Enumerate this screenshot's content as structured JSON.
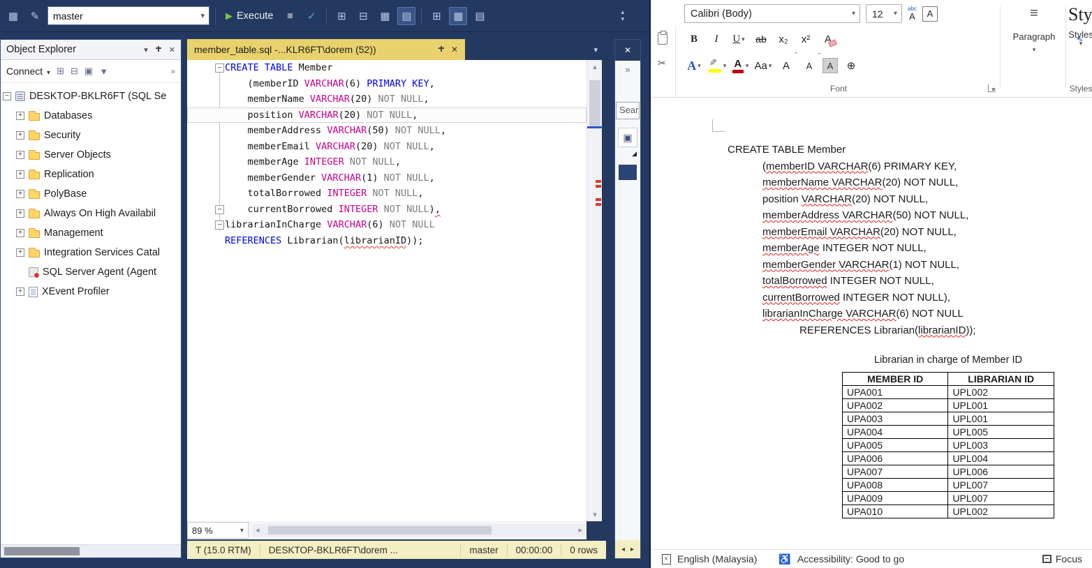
{
  "ssms": {
    "toolbar": {
      "database": "master",
      "execute": "Execute"
    },
    "object_explorer": {
      "title": "Object Explorer",
      "connect": "Connect",
      "tree": [
        {
          "label": "DESKTOP-BKLR6FT (SQL Se",
          "icon": "server",
          "expander": "minus",
          "root": true
        },
        {
          "label": "Databases",
          "icon": "folder",
          "expander": "plus"
        },
        {
          "label": "Security",
          "icon": "folder",
          "expander": "plus"
        },
        {
          "label": "Server Objects",
          "icon": "folder",
          "expander": "plus"
        },
        {
          "label": "Replication",
          "icon": "folder",
          "expander": "plus"
        },
        {
          "label": "PolyBase",
          "icon": "folder",
          "expander": "plus"
        },
        {
          "label": "Always On High Availabil",
          "icon": "folder",
          "expander": "plus"
        },
        {
          "label": "Management",
          "icon": "folder",
          "expander": "plus"
        },
        {
          "label": "Integration Services Catal",
          "icon": "folder",
          "expander": "plus"
        },
        {
          "label": "SQL Server Agent (Agent",
          "icon": "agent",
          "expander": "none"
        },
        {
          "label": "XEvent Profiler",
          "icon": "profiler",
          "expander": "plus"
        }
      ]
    },
    "editor": {
      "tab_title": "member_table.sql -...KLR6FT\\dorem (52))",
      "zoom": "89 %",
      "lines": [
        {
          "fold": true,
          "tokens": [
            {
              "t": "CREATE TABLE",
              "c": "kw"
            },
            {
              "t": " Member",
              "c": "id"
            }
          ]
        },
        {
          "tokens": [
            {
              "t": "    (memberID ",
              "c": "id"
            },
            {
              "t": "VARCHAR",
              "c": "type"
            },
            {
              "t": "(6) ",
              "c": "id"
            },
            {
              "t": "PRIMARY KEY",
              "c": "kw"
            },
            {
              "t": ",",
              "c": "id"
            }
          ]
        },
        {
          "tokens": [
            {
              "t": "    memberName ",
              "c": "id"
            },
            {
              "t": "VARCHAR",
              "c": "type"
            },
            {
              "t": "(20) ",
              "c": "id"
            },
            {
              "t": "NOT NULL",
              "c": "gray"
            },
            {
              "t": ",",
              "c": "id"
            }
          ]
        },
        {
          "current": true,
          "tokens": [
            {
              "t": "    position ",
              "c": "id"
            },
            {
              "t": "VARCHAR",
              "c": "type"
            },
            {
              "t": "(20) ",
              "c": "id"
            },
            {
              "t": "NOT NULL",
              "c": "gray"
            },
            {
              "t": ",",
              "c": "id"
            }
          ]
        },
        {
          "tokens": [
            {
              "t": "    memberAddress ",
              "c": "id"
            },
            {
              "t": "VARCHAR",
              "c": "type"
            },
            {
              "t": "(50) ",
              "c": "id"
            },
            {
              "t": "NOT NULL",
              "c": "gray"
            },
            {
              "t": ",",
              "c": "id"
            }
          ]
        },
        {
          "tokens": [
            {
              "t": "    memberEmail ",
              "c": "id"
            },
            {
              "t": "VARCHAR",
              "c": "type"
            },
            {
              "t": "(20) ",
              "c": "id"
            },
            {
              "t": "NOT NULL",
              "c": "gray"
            },
            {
              "t": ",",
              "c": "id"
            }
          ]
        },
        {
          "tokens": [
            {
              "t": "    memberAge ",
              "c": "id"
            },
            {
              "t": "INTEGER",
              "c": "type"
            },
            {
              "t": " ",
              "c": "id"
            },
            {
              "t": "NOT NULL",
              "c": "gray"
            },
            {
              "t": ",",
              "c": "id"
            }
          ]
        },
        {
          "tokens": [
            {
              "t": "    memberGender ",
              "c": "id"
            },
            {
              "t": "VARCHAR",
              "c": "type"
            },
            {
              "t": "(1) ",
              "c": "id"
            },
            {
              "t": "NOT NULL",
              "c": "gray"
            },
            {
              "t": ",",
              "c": "id"
            }
          ]
        },
        {
          "tokens": [
            {
              "t": "    totalBorrowed ",
              "c": "id"
            },
            {
              "t": "INTEGER",
              "c": "type"
            },
            {
              "t": " ",
              "c": "id"
            },
            {
              "t": "NOT NULL",
              "c": "gray"
            },
            {
              "t": ",",
              "c": "id"
            }
          ]
        },
        {
          "fold": true,
          "tokens": [
            {
              "t": "    currentBorrowed ",
              "c": "id"
            },
            {
              "t": "INTEGER",
              "c": "type"
            },
            {
              "t": " ",
              "c": "id"
            },
            {
              "t": "NOT NULL",
              "c": "gray"
            },
            {
              "t": ")",
              "c": "id"
            },
            {
              "t": ",",
              "c": "sq"
            }
          ]
        },
        {
          "fold": true,
          "tokens": [
            {
              "t": "librarianInCharge ",
              "c": "id"
            },
            {
              "t": "VARCHAR",
              "c": "type"
            },
            {
              "t": "(6) ",
              "c": "id"
            },
            {
              "t": "NOT NULL",
              "c": "gray"
            }
          ]
        },
        {
          "tokens": [
            {
              "t": "REFERENCES",
              "c": "kw"
            },
            {
              "t": " Librarian(",
              "c": "id"
            },
            {
              "t": "librarianID",
              "c": "sq"
            },
            {
              "t": "));",
              "c": "id"
            }
          ]
        }
      ]
    },
    "search_panel": {
      "text": "Sear"
    },
    "status_bar": {
      "version": "T (15.0 RTM)",
      "server": "DESKTOP-BKLR6FT\\dorem ...",
      "database": "master",
      "time": "00:00:00",
      "rows": "0 rows"
    }
  },
  "word": {
    "ribbon": {
      "font_name": "Calibri (Body)",
      "font_size": "12",
      "bold": "B",
      "italic": "I",
      "underline": "U",
      "strikethrough": "ab",
      "subscript": "x₂",
      "superscript": "x²",
      "change_case": "Aa",
      "text_effects_letter": "A",
      "grow_letter": "A",
      "shrink_letter": "A",
      "shading_letter": "A",
      "border_letter": "A",
      "clear_letter": "A",
      "phonetic_top": "abc",
      "phonetic_bottom": "A",
      "font_color_letter": "A",
      "font_group": "Font",
      "paragraph_group": "Paragraph",
      "styles_group": "Styles",
      "styles_button": "Styles"
    },
    "document": {
      "code_lines": [
        {
          "indent": 1,
          "parts": [
            {
              "t": "CREATE TABLE Member"
            }
          ]
        },
        {
          "indent": 2,
          "parts": [
            {
              "t": "("
            },
            {
              "t": "memberID VARCHAR",
              "sq": true
            },
            {
              "t": "(6) PRIMARY KEY,"
            }
          ]
        },
        {
          "indent": 2,
          "parts": [
            {
              "t": "memberName VARCHAR",
              "sq": true
            },
            {
              "t": "(20) NOT NULL,"
            }
          ]
        },
        {
          "indent": 2,
          "parts": [
            {
              "t": "position "
            },
            {
              "t": "VARCHAR",
              "sq": true
            },
            {
              "t": "(20) NOT NULL,"
            }
          ]
        },
        {
          "indent": 2,
          "parts": [
            {
              "t": "memberAddress VARCHAR",
              "sq": true
            },
            {
              "t": "(50) NOT NULL,"
            }
          ]
        },
        {
          "indent": 2,
          "parts": [
            {
              "t": "memberEmail VARCHAR",
              "sq": true
            },
            {
              "t": "(20) NOT NULL,"
            }
          ]
        },
        {
          "indent": 2,
          "parts": [
            {
              "t": "memberAge",
              "sq": true
            },
            {
              "t": " INTEGER NOT NULL,"
            }
          ]
        },
        {
          "indent": 2,
          "parts": [
            {
              "t": "memberGender VARCHAR",
              "sq": true
            },
            {
              "t": "(1) NOT NULL,"
            }
          ]
        },
        {
          "indent": 2,
          "parts": [
            {
              "t": "totalBorrowed",
              "sq": true
            },
            {
              "t": " INTEGER NOT NULL,"
            }
          ]
        },
        {
          "indent": 2,
          "parts": [
            {
              "t": "currentBorrowed",
              "sq": true
            },
            {
              "t": " INTEGER NOT NULL),"
            }
          ]
        },
        {
          "indent": 2,
          "parts": [
            {
              "t": "librarianInCharge VARCHAR",
              "sq": true
            },
            {
              "t": "(6) NOT NULL"
            }
          ]
        },
        {
          "indent": 3,
          "parts": [
            {
              "t": "REFERENCES Librarian("
            },
            {
              "t": "librarianID",
              "sq": true
            },
            {
              "t": "));"
            }
          ]
        }
      ],
      "table_caption": "Librarian in charge of Member ID",
      "table": {
        "headers": [
          "MEMBER ID",
          "LIBRARIAN ID"
        ],
        "rows": [
          [
            "UPA001",
            "UPL002"
          ],
          [
            "UPA002",
            "UPL001"
          ],
          [
            "UPA003",
            "UPL001"
          ],
          [
            "UPA004",
            "UPL005"
          ],
          [
            "UPA005",
            "UPL003"
          ],
          [
            "UPA006",
            "UPL004"
          ],
          [
            "UPA007",
            "UPL006"
          ],
          [
            "UPA008",
            "UPL007"
          ],
          [
            "UPA009",
            "UPL007"
          ],
          [
            "UPA010",
            "UPL002"
          ]
        ]
      }
    },
    "status_bar": {
      "language": "English (Malaysia)",
      "accessibility": "Accessibility: Good to go",
      "focus": "Focus"
    }
  },
  "icons": {
    "play": "▶",
    "stop": "■",
    "check": "✓",
    "close": "✕",
    "caret_down": "▾",
    "caret_up": "▴",
    "left": "◂",
    "right": "▸",
    "up": "▲",
    "down": "▼",
    "chevrons": "»",
    "overflow": "⋮",
    "grid": "▦",
    "rows": "▤",
    "winplus": "⊞",
    "winminus": "⊟",
    "box": "▣",
    "tri_br": "◢",
    "pencil": "✎",
    "scissors": "✂",
    "accessibility": "♿",
    "enclose": "⊕",
    "lines": "≡",
    "minus": "−",
    "plus": "+"
  },
  "colors": {
    "accent_navy": "#24395f",
    "tab_yellow": "#e9d26d",
    "status_yellow": "#f3efc2",
    "keyword_blue": "#0000e8",
    "type_magenta": "#c8008c",
    "comment_gray": "#7d7d7d",
    "squiggle_red": "#e03c31",
    "highlight_yellow": "#ffff00",
    "font_color_red": "#c00000"
  }
}
